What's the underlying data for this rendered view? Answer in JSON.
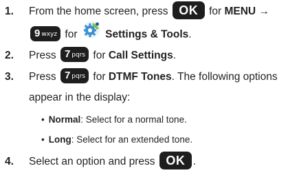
{
  "steps": [
    {
      "num": "1.",
      "pre": "From the home screen, press",
      "key1": "OK",
      "mid": "for",
      "menu": "MENU",
      "arrow": "→",
      "key2_digit": "9",
      "key2_letters": "wxyz",
      "for2": "for",
      "settings": "Settings & Tools",
      "period": "."
    },
    {
      "num": "2.",
      "pre": "Press",
      "key_digit": "7",
      "key_letters": "pqrs",
      "for": "for",
      "target": "Call Settings",
      "period": "."
    },
    {
      "num": "3.",
      "pre": "Press",
      "key_digit": "7",
      "key_letters": "pqrs",
      "for": "for",
      "target": "DTMF Tones",
      "rest": ". The following options",
      "line2": "appear in the display:"
    },
    {
      "num": "4.",
      "pre": "Select an option and press",
      "key": "OK",
      "period": "."
    }
  ],
  "options": [
    {
      "bullet": "•",
      "label": "Normal",
      "desc": ": Select for a normal tone."
    },
    {
      "bullet": "•",
      "label": "Long",
      "desc": ": Select for an extended tone."
    }
  ],
  "icons": {
    "settings_icon": "settings-tools-icon",
    "gear_color": "#3d8fcf",
    "gear_accent": "#7fc241"
  }
}
